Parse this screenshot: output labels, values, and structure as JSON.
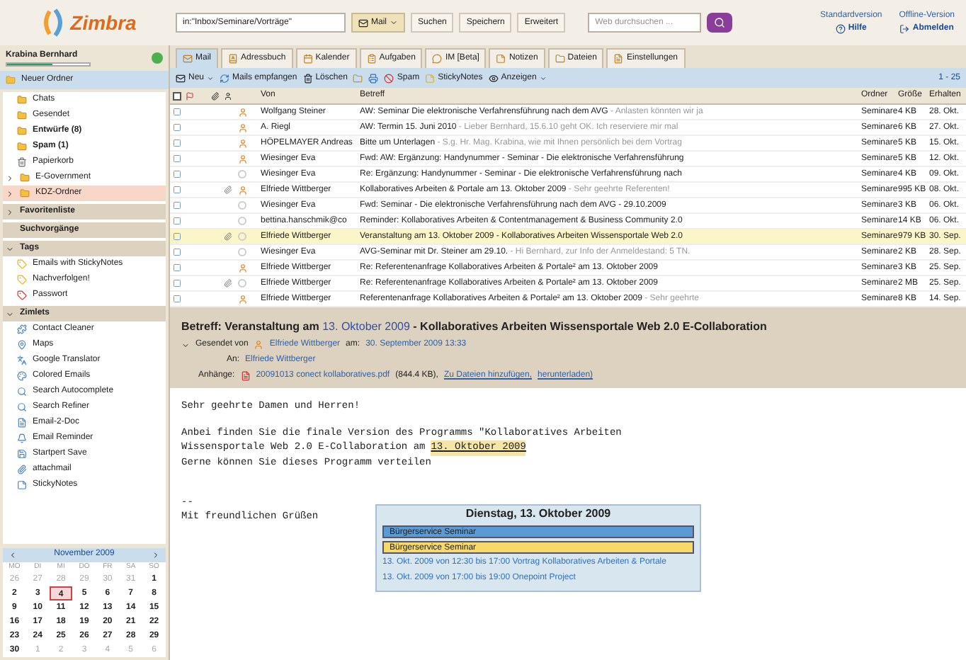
{
  "header": {
    "logo": "Zimbra",
    "search_value": "in:\"Inbox/Seminare/Vorträge\"",
    "search_type": "Mail",
    "buttons": [
      "Suchen",
      "Speichern",
      "Erweitert"
    ],
    "web_search_placeholder": "Web durchsuchen ...",
    "links": [
      {
        "label": "Standardversion",
        "action": "Hilfe"
      },
      {
        "label": "Offline-Version",
        "action": "Abmelden"
      }
    ]
  },
  "user": {
    "name": "Krabina Bernhard",
    "quota": {
      "level": 0.55
    }
  },
  "new_folder": "Neuer Ordner",
  "folders": [
    {
      "kind": "folder",
      "label": "Chats",
      "unread": false,
      "selected": false
    },
    {
      "kind": "folder",
      "label": "Gesendet",
      "unread": false,
      "selected": false
    },
    {
      "kind": "folder",
      "label": "Entwürfe (8)",
      "unread": true,
      "selected": false
    },
    {
      "kind": "folder",
      "label": "Spam (1)",
      "unread": true,
      "selected": false
    },
    {
      "kind": "trash",
      "label": "Papierkorb",
      "unread": false,
      "selected": false
    },
    {
      "kind": "group",
      "label": "E-Government",
      "unread": false,
      "selected": false
    },
    {
      "kind": "group",
      "label": "KDZ-Ordner",
      "unread": false,
      "selected": true
    }
  ],
  "sections": [
    {
      "kind": "collapsible",
      "title": "Favoritenliste",
      "expanded": false
    },
    {
      "kind": "plain",
      "title": "Suchvorgänge"
    },
    {
      "kind": "collapsible",
      "title": "Tags",
      "expanded": true,
      "items": [
        "Emails with StickyNotes",
        "Nachverfolgen!",
        "Passwort"
      ]
    },
    {
      "kind": "collapsible",
      "title": "Zimlets",
      "expanded": true,
      "items": [
        "Contact Cleaner",
        "Maps",
        "Google Translator",
        "Colored Emails",
        "Search Autocomplete",
        "Search Refiner",
        "Email-2-Doc",
        "Email Reminder",
        "Startpert Save",
        "attachmail",
        "StickyNotes"
      ]
    }
  ],
  "calendar": {
    "month": "November 2009",
    "weekdays": [
      "MO",
      "DI",
      "MI",
      "DO",
      "FR",
      "SA",
      "SO"
    ],
    "weeks": [
      [
        {
          "d": "26",
          "other": true,
          "selected": false
        },
        {
          "d": "27",
          "other": true,
          "selected": false
        },
        {
          "d": "28",
          "other": true,
          "selected": false
        },
        {
          "d": "29",
          "other": true,
          "selected": false
        },
        {
          "d": "30",
          "other": true,
          "selected": false
        },
        {
          "d": "31",
          "other": true,
          "selected": false
        },
        {
          "d": "1",
          "other": false,
          "selected": false
        }
      ],
      [
        {
          "d": "2",
          "other": false,
          "selected": false
        },
        {
          "d": "3",
          "other": false,
          "selected": false
        },
        {
          "d": "4",
          "other": false,
          "selected": true
        },
        {
          "d": "5",
          "other": false,
          "selected": false
        },
        {
          "d": "6",
          "other": false,
          "selected": false
        },
        {
          "d": "7",
          "other": false,
          "selected": false
        },
        {
          "d": "8",
          "other": false,
          "selected": false
        }
      ],
      [
        {
          "d": "9",
          "other": false,
          "selected": false
        },
        {
          "d": "10",
          "other": false,
          "selected": false
        },
        {
          "d": "11",
          "other": false,
          "selected": false
        },
        {
          "d": "12",
          "other": false,
          "selected": false
        },
        {
          "d": "13",
          "other": false,
          "selected": false
        },
        {
          "d": "14",
          "other": false,
          "selected": false
        },
        {
          "d": "15",
          "other": false,
          "selected": false
        }
      ],
      [
        {
          "d": "16",
          "other": false,
          "selected": false
        },
        {
          "d": "17",
          "other": false,
          "selected": false
        },
        {
          "d": "18",
          "other": false,
          "selected": false
        },
        {
          "d": "19",
          "other": false,
          "selected": false
        },
        {
          "d": "20",
          "other": false,
          "selected": false
        },
        {
          "d": "21",
          "other": false,
          "selected": false
        },
        {
          "d": "22",
          "other": false,
          "selected": false
        }
      ],
      [
        {
          "d": "23",
          "other": false,
          "selected": false
        },
        {
          "d": "24",
          "other": false,
          "selected": false
        },
        {
          "d": "25",
          "other": false,
          "selected": false
        },
        {
          "d": "26",
          "other": false,
          "selected": false
        },
        {
          "d": "27",
          "other": false,
          "selected": false
        },
        {
          "d": "28",
          "other": false,
          "selected": false
        },
        {
          "d": "29",
          "other": false,
          "selected": false
        }
      ],
      [
        {
          "d": "30",
          "other": false,
          "selected": false
        },
        {
          "d": "1",
          "other": true,
          "selected": false
        },
        {
          "d": "2",
          "other": true,
          "selected": false
        },
        {
          "d": "3",
          "other": true,
          "selected": false
        },
        {
          "d": "4",
          "other": true,
          "selected": false
        },
        {
          "d": "5",
          "other": true,
          "selected": false
        },
        {
          "d": "6",
          "other": true,
          "selected": false
        }
      ]
    ]
  },
  "tabs": [
    {
      "label": "Mail",
      "selected": true
    },
    {
      "label": "Adressbuch",
      "selected": false
    },
    {
      "label": "Kalender",
      "selected": false
    },
    {
      "label": "Aufgaben",
      "selected": false
    },
    {
      "label": "IM [Beta]",
      "selected": false
    },
    {
      "label": "Notizen",
      "selected": false
    },
    {
      "label": "Dateien",
      "selected": false
    },
    {
      "label": "Einstellungen",
      "selected": false
    }
  ],
  "toolbar": {
    "new": "Neu",
    "receive": "Mails empfangen",
    "delete": "Löschen",
    "spam": "Spam",
    "stickynotes": "StickyNotes",
    "view": "Anzeigen",
    "paging": "1 - 25"
  },
  "columns": [
    "Von",
    "Betreff",
    "Ordner",
    "Größe",
    "Erhalten"
  ],
  "select_all": {
    "checked": false
  },
  "messages": [
    {
      "from": "Wolfgang Steiner",
      "subject": "AW: Seminar Die elektronische Verfahrensführung nach dem AVG",
      "excerpt": " - Anlasten könnten wir ja",
      "folder": "Seminare",
      "size": "4 KB",
      "date": "28. Okt.",
      "attachment": false,
      "known": true,
      "selected": false
    },
    {
      "from": "A. Riegl",
      "subject": "AW: Termin 15. Juni 2010",
      "excerpt": " - Lieber Bernhard, 15.6.10 geht OK. Ich reserviere mir mal",
      "folder": "Seminare",
      "size": "6 KB",
      "date": "27. Okt.",
      "attachment": false,
      "known": true,
      "selected": false
    },
    {
      "from": "HÖPELMAYER Andreas",
      "subject": "Bitte um Unterlagen",
      "excerpt": " - S.g. Hr. Mag. Krabina, wie mit Ihnen persönlich bei dem Vortrag",
      "folder": "Seminare",
      "size": "5 KB",
      "date": "15. Okt.",
      "attachment": false,
      "known": true,
      "selected": false
    },
    {
      "from": "Wiesinger Eva",
      "subject": "Fwd: AW: Ergänzung: Handynummer - Seminar - Die elektronische Verfahrensführung",
      "folder": "Seminare",
      "size": "5 KB",
      "date": "12. Okt.",
      "attachment": false,
      "known": true,
      "selected": false
    },
    {
      "from": "Wiesinger Eva",
      "subject": "Re: Ergänzung: Handynummer - Seminar - Die elektronische Verfahrensführung nach",
      "folder": "Seminare",
      "size": "4 KB",
      "date": "09. Okt.",
      "attachment": false,
      "known": false,
      "selected": false
    },
    {
      "from": "Elfriede Wittberger",
      "subject": "Kollaboratives Arbeiten & Portale am 13. Oktober 2009",
      "excerpt": " - Sehr geehrte Referenten!",
      "folder": "Seminare",
      "size": "995 KB",
      "date": "08. Okt.",
      "attachment": true,
      "known": true,
      "selected": false
    },
    {
      "from": "Wiesinger Eva",
      "subject": "Fwd: Seminar - Die elektronische Verfahrensführung nach dem AVG - 29.10.2009",
      "folder": "Seminare",
      "size": "3 KB",
      "date": "06. Okt.",
      "attachment": false,
      "known": false,
      "selected": false
    },
    {
      "from": "bettina.hanschmik@co",
      "subject": "Reminder: Kollaboratives Arbeiten & Contentmanagement & Business Community 2.0",
      "folder": "Seminare",
      "size": "14 KB",
      "date": "06. Okt.",
      "attachment": false,
      "known": false,
      "selected": false
    },
    {
      "from": "Elfriede Wittberger",
      "subject": "Veranstaltung am 13. Oktober 2009 - Kollaboratives Arbeiten Wissensportale Web 2.0",
      "folder": "Seminare",
      "size": "979 KB",
      "date": "30. Sep.",
      "attachment": true,
      "known": false,
      "selected": true
    },
    {
      "from": "Wiesinger Eva",
      "subject": "AVG-Seminar mit Dr. Steiner am 29.10.",
      "excerpt": " - Hi Bernhard, zur Info der Anmeldestand: 5 TN.",
      "folder": "Seminare",
      "size": "2 KB",
      "date": "28. Sep.",
      "attachment": false,
      "known": false,
      "selected": false
    },
    {
      "from": "Elfriede Wittberger",
      "subject": "Re: Referentenanfrage Kollaboratives Arbeiten & Portale² am 13. Oktober 2009",
      "folder": "Seminare",
      "size": "3 KB",
      "date": "25. Sep.",
      "attachment": false,
      "known": true,
      "selected": false
    },
    {
      "from": "Elfriede Wittberger",
      "subject": "Re: Referentenanfrage Kollaboratives Arbeiten & Portale² am 13. Oktober 2009",
      "folder": "Seminare",
      "size": "2 MB",
      "date": "25. Sep.",
      "attachment": true,
      "known": false,
      "selected": false
    },
    {
      "from": "Elfriede Wittberger",
      "subject": "Referentenanfrage Kollaboratives Arbeiten & Portale² am 13. Oktober 2009",
      "excerpt": " - Sehr geehrte",
      "folder": "Seminare",
      "size": "8 KB",
      "date": "14. Sep.",
      "attachment": false,
      "known": true,
      "selected": false
    }
  ],
  "reading": {
    "subject_prefix": "Betreff: Veranstaltung am",
    "subject_date": "13. Oktober 2009",
    "subject_suffix": "- Kollaboratives Arbeiten Wissensportale Web 2.0 E-Collaboration",
    "from_label": "Gesendet von",
    "from": "Elfriede Wittberger",
    "date_label": "am:",
    "date": "30. September 2009 13:33",
    "to_label": "An:",
    "to": "Elfriede Wittberger",
    "attach_label": "Anhänge:",
    "attachment": "20091013 conect kollaboratives.pdf",
    "attachment_size": "(844.4 KB),",
    "attach_links": [
      "Zu Dateien hinzufügen,",
      "herunterladen)"
    ],
    "body": [
      {
        "kind": "line",
        "text": "Sehr geehrte Damen und Herren!"
      },
      {
        "kind": "gap"
      },
      {
        "kind": "line",
        "text": "Anbei finden Sie die finale Version des Programms \"Kollaboratives Arbeiten"
      },
      {
        "kind": "date",
        "text": "Wissensportale Web 2.0 E-Collaboration am",
        "date": "13. Oktober 2009"
      },
      {
        "kind": "line",
        "text": "Gerne können Sie dieses Programm verteilen"
      },
      {
        "kind": "gap"
      },
      {
        "kind": "gap"
      },
      {
        "kind": "line",
        "text": "--"
      },
      {
        "kind": "line",
        "text": "Mit freundlichen Grüßen"
      }
    ],
    "popup": {
      "title": "Dienstag, 13. Oktober 2009",
      "events": [
        {
          "label": "Bürgerservice Seminar",
          "color": "#5b9bd5"
        },
        {
          "label": "Bürgerservice Seminar",
          "color": "#f6d86b"
        }
      ],
      "appointments": [
        "13. Okt. 2009 von 12:30 bis 17:00 Vortrag Kollaboratives Arbeiten & Portale",
        "13. Okt. 2009 von 17:00 bis 19:00 Onepoint Project"
      ]
    }
  }
}
